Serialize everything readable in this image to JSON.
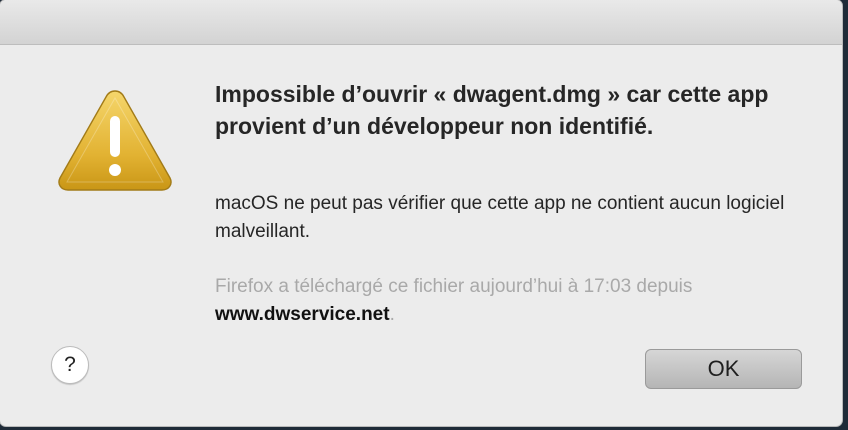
{
  "dialog": {
    "title": "Impossible d’ouvrir « dwagent.dmg » car cette app provient d’un développeur non identifié.",
    "message": "macOS ne peut pas vérifier que cette app ne contient aucun logiciel malveillant.",
    "info_prefix": "Firefox a téléchargé ce fichier aujourd’hui à 17:03 depuis ",
    "info_domain": "www.dwservice.net",
    "info_suffix": ".",
    "help_label": "?",
    "ok_label": "OK"
  },
  "icons": {
    "warning": "warning-icon",
    "help": "help-icon"
  },
  "colors": {
    "warning_fill": "#e6b83a",
    "ok_button": "#b8b8b8",
    "info_text": "#a9a9a9"
  }
}
